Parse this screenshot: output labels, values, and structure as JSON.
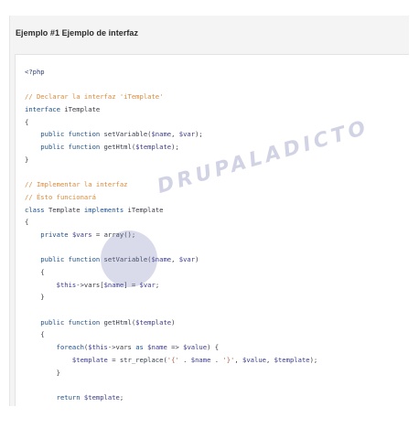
{
  "example": {
    "title": "Ejemplo #1 Ejemplo de interfaz"
  },
  "watermark": {
    "text": "DRUPALADICTO"
  },
  "code": {
    "lines": [
      [
        {
          "t": "tag",
          "s": "<?php"
        }
      ],
      [],
      [
        {
          "t": "comment",
          "s": "// Declarar la interfaz 'iTemplate'"
        }
      ],
      [
        {
          "t": "kw",
          "s": "interface "
        },
        {
          "t": "plain",
          "s": "iTemplate"
        }
      ],
      [
        {
          "t": "plain",
          "s": "{"
        }
      ],
      [
        {
          "t": "kw",
          "s": "    public function "
        },
        {
          "t": "fn",
          "s": "setVariable"
        },
        {
          "t": "plain",
          "s": "("
        },
        {
          "t": "var",
          "s": "$name"
        },
        {
          "t": "plain",
          "s": ", "
        },
        {
          "t": "var",
          "s": "$var"
        },
        {
          "t": "plain",
          "s": ");"
        }
      ],
      [
        {
          "t": "kw",
          "s": "    public function "
        },
        {
          "t": "fn",
          "s": "getHtml"
        },
        {
          "t": "plain",
          "s": "("
        },
        {
          "t": "var",
          "s": "$template"
        },
        {
          "t": "plain",
          "s": ");"
        }
      ],
      [
        {
          "t": "plain",
          "s": "}"
        }
      ],
      [],
      [
        {
          "t": "comment",
          "s": "// Implementar la interfaz"
        }
      ],
      [
        {
          "t": "comment",
          "s": "// Ésto funcionará"
        }
      ],
      [
        {
          "t": "kw",
          "s": "class "
        },
        {
          "t": "plain",
          "s": "Template "
        },
        {
          "t": "kw",
          "s": "implements "
        },
        {
          "t": "plain",
          "s": "iTemplate"
        }
      ],
      [
        {
          "t": "plain",
          "s": "{"
        }
      ],
      [
        {
          "t": "kw",
          "s": "    private "
        },
        {
          "t": "var",
          "s": "$vars"
        },
        {
          "t": "plain",
          "s": " = "
        },
        {
          "t": "fn",
          "s": "array"
        },
        {
          "t": "plain",
          "s": "();"
        }
      ],
      [],
      [
        {
          "t": "kw",
          "s": "    public function "
        },
        {
          "t": "fn",
          "s": "setVariable"
        },
        {
          "t": "plain",
          "s": "("
        },
        {
          "t": "var",
          "s": "$name"
        },
        {
          "t": "plain",
          "s": ", "
        },
        {
          "t": "var",
          "s": "$var"
        },
        {
          "t": "plain",
          "s": ")"
        }
      ],
      [
        {
          "t": "plain",
          "s": "    {"
        }
      ],
      [
        {
          "t": "var",
          "s": "        $this"
        },
        {
          "t": "plain",
          "s": "->"
        },
        {
          "t": "plain",
          "s": "vars"
        },
        {
          "t": "plain",
          "s": "["
        },
        {
          "t": "var",
          "s": "$name"
        },
        {
          "t": "plain",
          "s": "] = "
        },
        {
          "t": "var",
          "s": "$var"
        },
        {
          "t": "plain",
          "s": ";"
        }
      ],
      [
        {
          "t": "plain",
          "s": "    }"
        }
      ],
      [],
      [
        {
          "t": "kw",
          "s": "    public function "
        },
        {
          "t": "fn",
          "s": "getHtml"
        },
        {
          "t": "plain",
          "s": "("
        },
        {
          "t": "var",
          "s": "$template"
        },
        {
          "t": "plain",
          "s": ")"
        }
      ],
      [
        {
          "t": "plain",
          "s": "    {"
        }
      ],
      [
        {
          "t": "kw",
          "s": "        foreach"
        },
        {
          "t": "plain",
          "s": "("
        },
        {
          "t": "var",
          "s": "$this"
        },
        {
          "t": "plain",
          "s": "->vars "
        },
        {
          "t": "kw",
          "s": "as "
        },
        {
          "t": "var",
          "s": "$name"
        },
        {
          "t": "plain",
          "s": " => "
        },
        {
          "t": "var",
          "s": "$value"
        },
        {
          "t": "plain",
          "s": ") {"
        }
      ],
      [
        {
          "t": "var",
          "s": "            $template"
        },
        {
          "t": "plain",
          "s": " = "
        },
        {
          "t": "fn",
          "s": "str_replace"
        },
        {
          "t": "plain",
          "s": "("
        },
        {
          "t": "str",
          "s": "'{'"
        },
        {
          "t": "plain",
          "s": " . "
        },
        {
          "t": "var",
          "s": "$name"
        },
        {
          "t": "plain",
          "s": " . "
        },
        {
          "t": "str",
          "s": "'}'"
        },
        {
          "t": "plain",
          "s": ", "
        },
        {
          "t": "var",
          "s": "$value"
        },
        {
          "t": "plain",
          "s": ", "
        },
        {
          "t": "var",
          "s": "$template"
        },
        {
          "t": "plain",
          "s": ");"
        }
      ],
      [
        {
          "t": "plain",
          "s": "        }"
        }
      ],
      [],
      [
        {
          "t": "kw",
          "s": "        return "
        },
        {
          "t": "var",
          "s": "$template"
        },
        {
          "t": "plain",
          "s": ";"
        }
      ],
      [
        {
          "t": "plain",
          "s": "    }"
        }
      ],
      [
        {
          "t": "plain",
          "s": "}"
        }
      ]
    ]
  }
}
